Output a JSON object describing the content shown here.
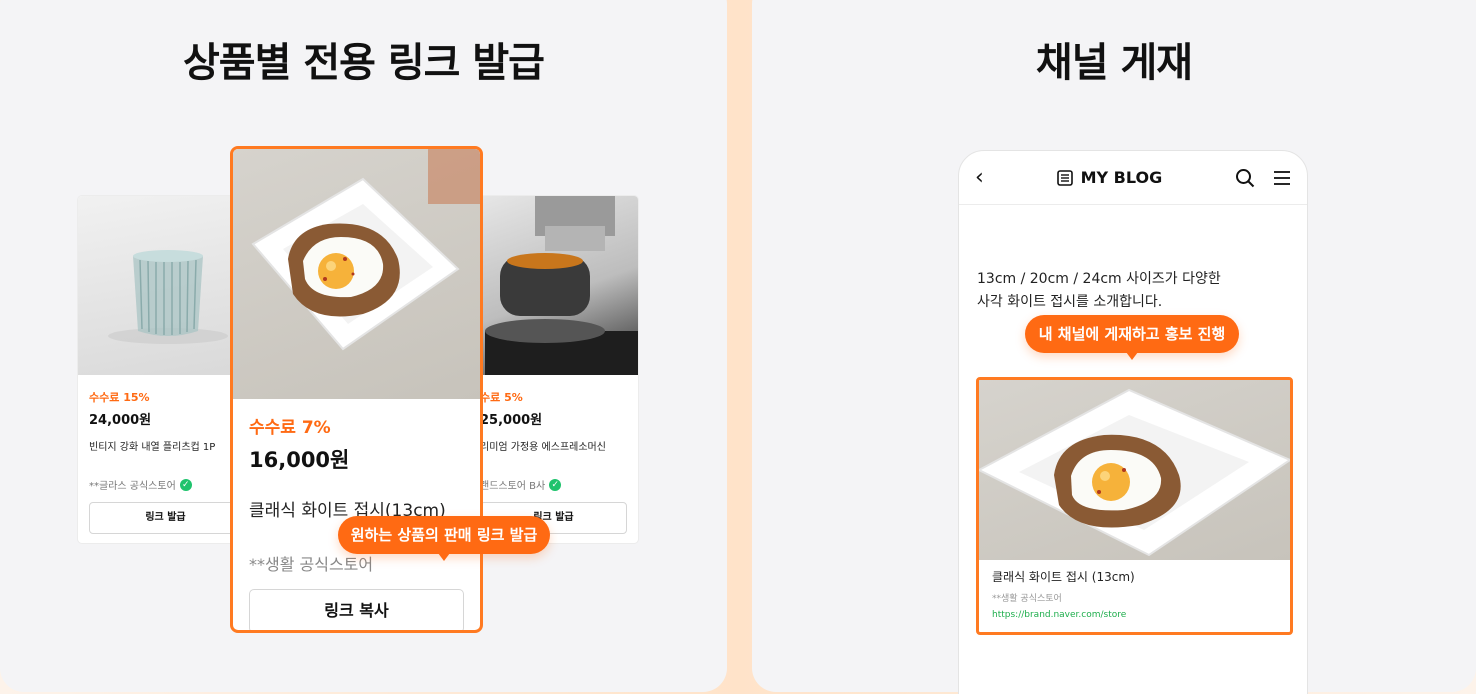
{
  "left_panel": {
    "title": "상품별 전용 링크 발급",
    "cards": [
      {
        "commission": "수수료 15%",
        "price": "24,000원",
        "name": "빈티지 강화 내열 플리츠컵 1P",
        "store": "**글라스 공식스토어",
        "button": "링크 발급",
        "image": "glass-cup"
      },
      {
        "commission": "수수료 7%",
        "price": "16,000원",
        "name": "클래식 화이트 접시(13cm)",
        "store": "**생활 공식스토어",
        "button": "링크 복사",
        "image": "egg-toast-plate"
      },
      {
        "commission": "수료 5%",
        "price": "25,000원",
        "name": "리미엄 가정용 에스프레소머신",
        "store": "랜드스토어 B사",
        "button": "링크 발급",
        "image": "espresso-machine"
      }
    ],
    "tooltip": "원하는 상품의 판매 링크 발급"
  },
  "right_panel": {
    "title": "채널 게재",
    "phone": {
      "blog_title": "MY BLOG",
      "intro_line1": "13cm / 20cm / 24cm 사이즈가 다양한",
      "intro_line2": "사각 화이트 접시를 소개합니다.",
      "tooltip": "내 채널에 게재하고 홍보 진행",
      "post": {
        "title": "클래식 화이트 접시 (13cm)",
        "store": "**생활 공식스토어",
        "url": "https://brand.naver.com/store"
      }
    }
  },
  "colors": {
    "accent": "#ff6a13",
    "verified": "#1fc36d",
    "url": "#1fae4d"
  }
}
